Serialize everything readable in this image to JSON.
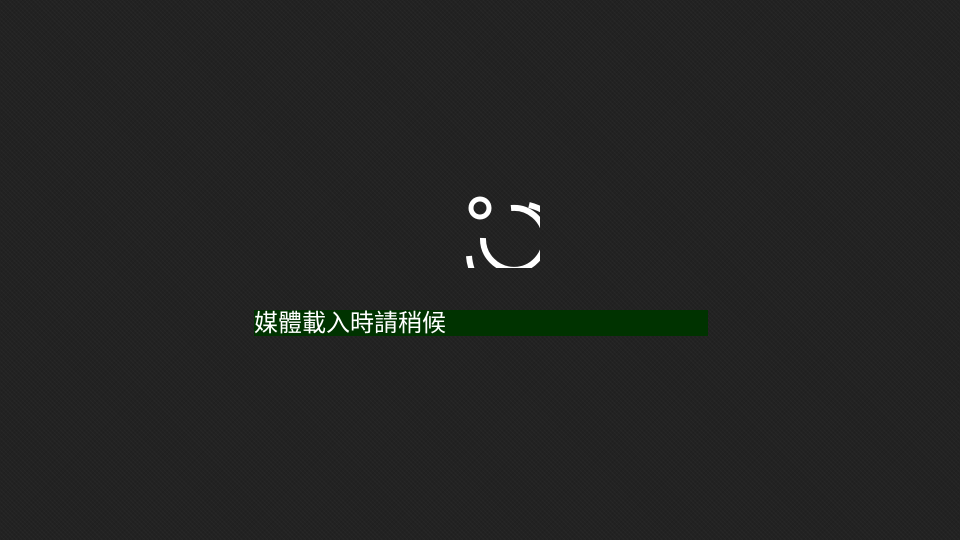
{
  "loading": {
    "message": "媒體載入時請稍候",
    "progress_percent": 100
  },
  "icons": {
    "media": "media-disc-icon"
  },
  "colors": {
    "background": "#222222",
    "foreground": "#ffffff",
    "progress_fill": "#003300"
  }
}
